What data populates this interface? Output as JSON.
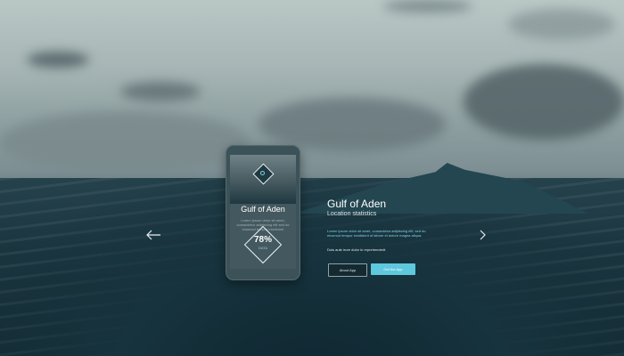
{
  "phone": {
    "title": "Gulf of Aden",
    "description": "Lorem ipsum dolor sit amet, consectetur adipiscing elit sed do eiusmod tempor incididunt",
    "percent": "78%",
    "percent_sub": "DATA"
  },
  "info": {
    "title": "Gulf of Aden",
    "subtitle": "Location statistics",
    "text": "Lorem ipsum dolor sit amet, consectetur adipiscing elit, sed do eiusmod tempor incididunt ut labore et dolore magna aliqua.",
    "small_text": "Duis aute irure dolor in reprehenderit."
  },
  "buttons": {
    "about": "About App",
    "get": "Get the App"
  },
  "nav": {
    "prev_icon": "chevron-left-icon",
    "next_icon": "chevron-right-icon"
  },
  "colors": {
    "accent": "#5ec8dd",
    "text_accent": "#7fd2e3"
  }
}
